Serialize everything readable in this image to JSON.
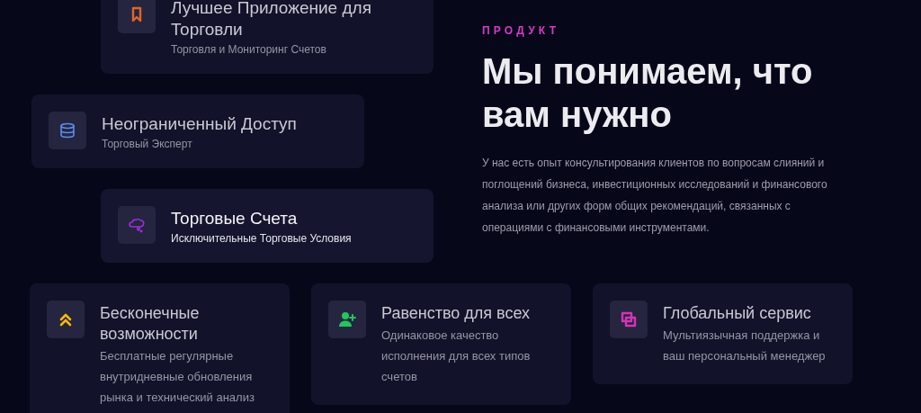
{
  "features": [
    {
      "kind": "bookmark",
      "color": "#e0652a",
      "title": "Лучшее Приложение для Торговли",
      "subtitle": "Торговля и Мониторинг Счетов",
      "active": false
    },
    {
      "kind": "database",
      "color": "#5b8def",
      "title": "Неограниченный Доступ",
      "subtitle": "Торговый Эксперт",
      "active": false
    },
    {
      "kind": "cloud",
      "color": "#9b30e0",
      "title": "Торговые Счета",
      "subtitle": "Исключительные Торговые Условия",
      "active": true
    }
  ],
  "product": {
    "eyebrow": "ПРОДУКТ",
    "heading": "Мы понимаем, что вам нужно",
    "text": "У нас есть опыт консультирования клиентов по вопросам слияний и поглощений бизнеса, инвестиционных исследований и финансового анализа или других форм общих рекомендаций, связанных с операциями с финансовыми инструментами."
  },
  "benefits": [
    {
      "kind": "chevrons",
      "color": "#f5b800",
      "title": "Бесконечные возможности",
      "text": "Бесплатные регулярные внутридневные обновления рынка и технический анализ"
    },
    {
      "kind": "user-plus",
      "color": "#22c55e",
      "title": "Равенство для всех",
      "text": "Одинаковое качество исполнения для всех типов счетов"
    },
    {
      "kind": "squares",
      "color": "#d633b8",
      "title": "Глобальный сервис",
      "text": "Мультиязычная поддержка и ваш персональный менеджер"
    }
  ]
}
